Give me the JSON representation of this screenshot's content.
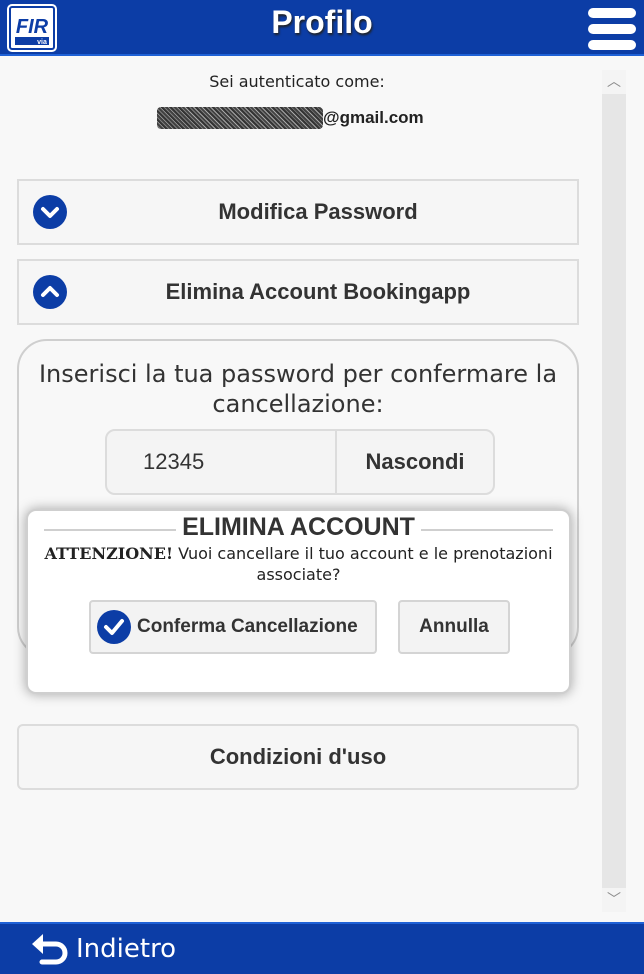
{
  "header": {
    "title": "Profilo",
    "logo_text": "FIR via",
    "menu_icon": "hamburger-menu-icon"
  },
  "auth": {
    "label": "Sei autenticato come:",
    "email_domain": "@gmail.com"
  },
  "sections": {
    "change_password": {
      "label": "Modifica Password",
      "state": "collapsed"
    },
    "delete_account": {
      "label": "Elimina Account Bookingapp",
      "state": "expanded"
    },
    "terms": {
      "label": "Condizioni d'uso"
    }
  },
  "delete_panel": {
    "prompt": "Inserisci la tua password per confermare la cancellazione:",
    "password_value": "12345",
    "toggle_label": "Nascondi"
  },
  "dialog": {
    "title": "ELIMINA ACCOUNT",
    "warning_label": "ATTENZIONE!",
    "message": "Vuoi cancellare il tuo account e le prenotazioni associate?",
    "confirm_label": "Conferma Cancellazione",
    "cancel_label": "Annulla"
  },
  "footer": {
    "back_label": "Indietro"
  },
  "colors": {
    "primary": "#0c3da6",
    "background": "#f8f8f8"
  }
}
